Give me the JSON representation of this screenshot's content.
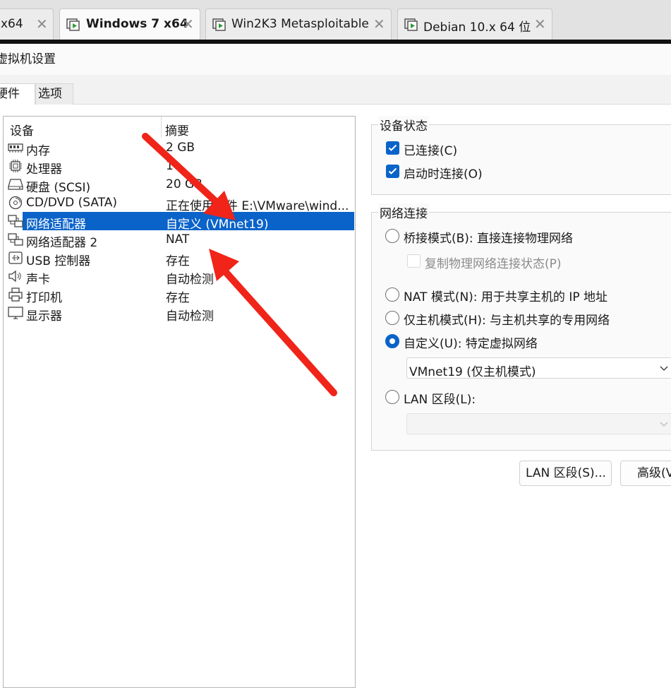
{
  "doc_tabs": [
    {
      "label": "x64",
      "active": false
    },
    {
      "label": "Windows 7 x64",
      "active": true
    },
    {
      "label": "Win2K3 Metasploitable",
      "active": false
    },
    {
      "label": "Debian 10.x 64 位",
      "active": false
    }
  ],
  "dialog": {
    "title": "虚拟机设置",
    "tabs": [
      "硬件",
      "选项"
    ]
  },
  "device_list": {
    "columns": [
      "设备",
      "摘要"
    ],
    "rows": [
      {
        "icon": "memory-icon",
        "name": "内存",
        "summary": "2 GB",
        "selected": false
      },
      {
        "icon": "processor-icon",
        "name": "处理器",
        "summary": "1",
        "selected": false
      },
      {
        "icon": "hard-disk-icon",
        "name": "硬盘 (SCSI)",
        "summary": "20 GB",
        "selected": false
      },
      {
        "icon": "cd-dvd-icon",
        "name": "CD/DVD (SATA)",
        "summary": "正在使用文件 E:\\VMware\\wind...",
        "selected": false
      },
      {
        "icon": "network-adapter-icon",
        "name": "网络适配器",
        "summary": "自定义 (VMnet19)",
        "selected": true
      },
      {
        "icon": "network-adapter-icon",
        "name": "网络适配器 2",
        "summary": "NAT",
        "selected": false
      },
      {
        "icon": "usb-icon",
        "name": "USB 控制器",
        "summary": "存在",
        "selected": false
      },
      {
        "icon": "speaker-icon",
        "name": "声卡",
        "summary": "自动检测",
        "selected": false
      },
      {
        "icon": "printer-icon",
        "name": "打印机",
        "summary": "存在",
        "selected": false
      },
      {
        "icon": "monitor-icon",
        "name": "显示器",
        "summary": "自动检测",
        "selected": false
      }
    ]
  },
  "device_status": {
    "title": "设备状态",
    "connected": {
      "label": "已连接(C)",
      "checked": true
    },
    "connect_at_power_on": {
      "label": "启动时连接(O)",
      "checked": true
    }
  },
  "network_connection": {
    "title": "网络连接",
    "bridged": {
      "label": "桥接模式(B): 直接连接物理网络",
      "selected": false
    },
    "replicate": {
      "label": "复制物理网络连接状态(P)",
      "checked": false,
      "enabled": false
    },
    "nat": {
      "label": "NAT 模式(N): 用于共享主机的 IP 地址",
      "selected": false
    },
    "host_only": {
      "label": "仅主机模式(H): 与主机共享的专用网络",
      "selected": false
    },
    "custom": {
      "label": "自定义(U): 特定虚拟网络",
      "selected": true
    },
    "custom_network": "VMnet19 (仅主机模式)",
    "lan_segment": {
      "label": "LAN 区段(L):",
      "selected": false
    },
    "lan_segment_value": ""
  },
  "buttons": {
    "lan_segments": "LAN 区段(S)...",
    "advanced": "高级(V)..."
  },
  "colors": {
    "accent": "#0a63c9",
    "annotation_arrow": "#f02419"
  }
}
